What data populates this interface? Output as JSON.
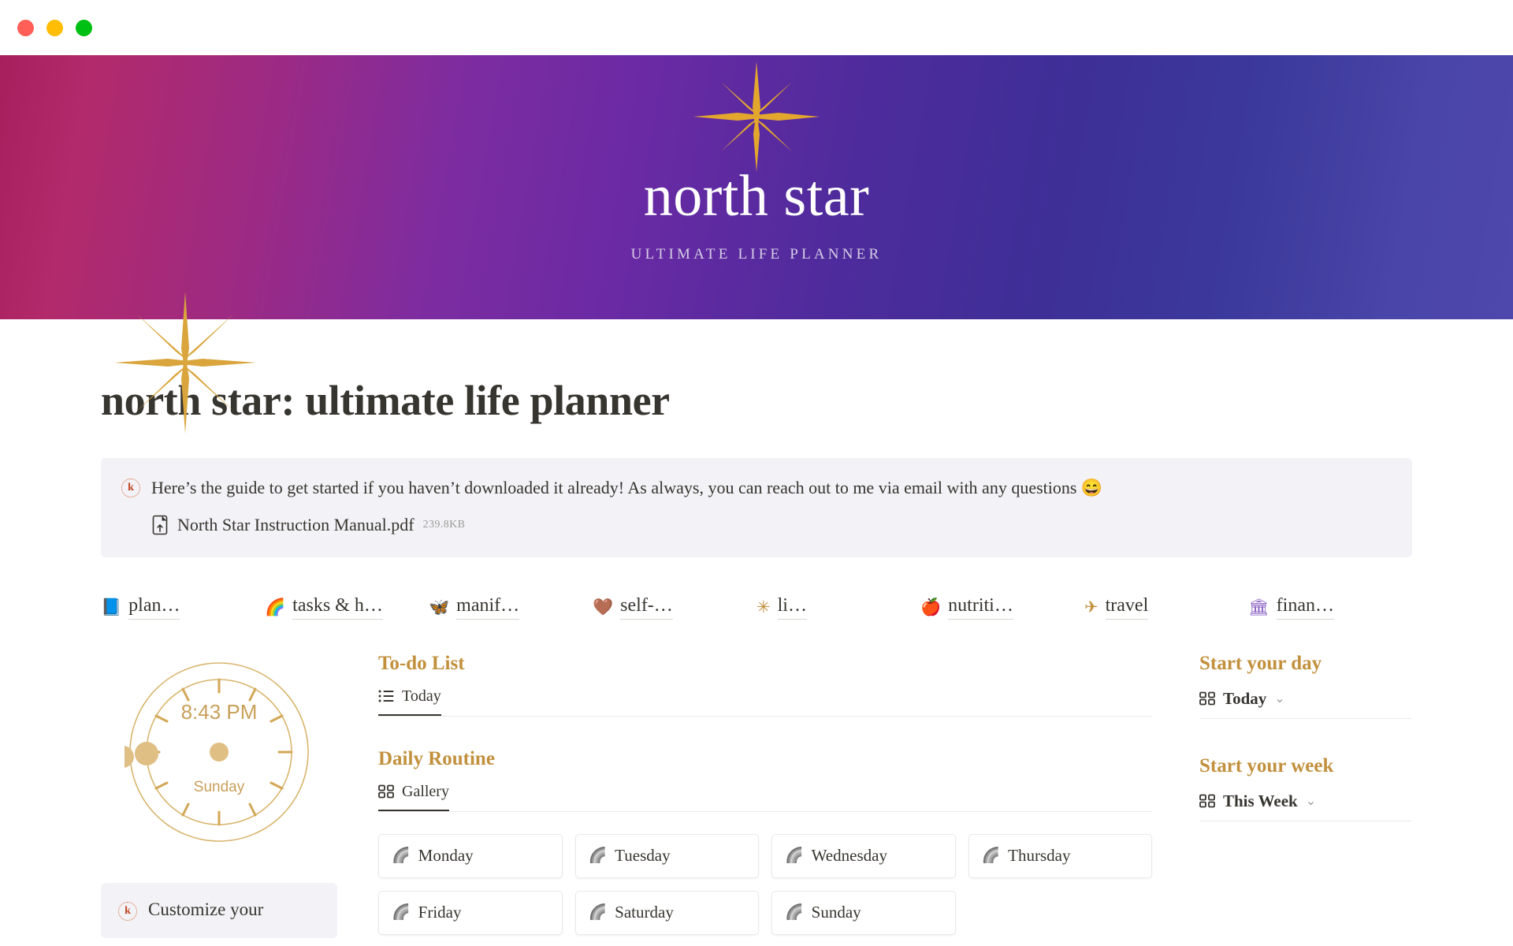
{
  "window": {
    "lights": [
      "close",
      "minimize",
      "zoom"
    ]
  },
  "banner": {
    "brand_name": "north star",
    "brand_subtitle": "ULTIMATE LIFE PLANNER",
    "star_icon": "four-point-star-icon",
    "corner_star_icon": "eight-point-star-icon",
    "gradient": [
      "#a81f5e",
      "#7d2ca0",
      "#3d2f96",
      "#4e47ac"
    ]
  },
  "page": {
    "title": "north star: ultimate life planner"
  },
  "callout": {
    "badge": "k",
    "text": "Here’s the guide to get started if you haven’t downloaded it already! As always, you can reach out to me via email with any questions 😄",
    "file": {
      "icon": "pdf-file-icon",
      "name": "North Star Instruction Manual.pdf",
      "size": "239.8KB"
    },
    "background": "#f3f2f7"
  },
  "tabs": [
    {
      "icon": "📘",
      "icon_name": "books-icon",
      "label": "plan…"
    },
    {
      "icon": "🌈",
      "icon_name": "rainbow-icon",
      "label": "tasks & h…"
    },
    {
      "icon": "🦋",
      "icon_name": "butterfly-icon",
      "label": "manif…"
    },
    {
      "icon": "🤎",
      "icon_name": "heart-icon",
      "label": "self-…"
    },
    {
      "icon": "✳",
      "icon_name": "sparkle-icon",
      "label": "li…"
    },
    {
      "icon": "🍎",
      "icon_name": "apple-icon",
      "label": "nutriti…"
    },
    {
      "icon": "✈",
      "icon_name": "airplane-icon",
      "label": "travel"
    },
    {
      "icon": "🏛",
      "icon_name": "bank-icon",
      "label": "finan…"
    }
  ],
  "clock": {
    "time": "8:43 PM",
    "day": "Sunday",
    "accent": "#d2a756"
  },
  "mini_callout": {
    "badge": "k",
    "text": "Customize your"
  },
  "sections": [
    {
      "title": "To-do List",
      "view_tab": {
        "label": "Today",
        "icon_name": "list-view-icon"
      }
    },
    {
      "title": "Daily Routine",
      "view_tab": {
        "label": "Gallery",
        "icon_name": "gallery-view-icon"
      }
    }
  ],
  "days": [
    {
      "icon": "🌈",
      "label": "Monday"
    },
    {
      "icon": "🌈",
      "label": "Tuesday"
    },
    {
      "icon": "🌈",
      "label": "Wednesday"
    },
    {
      "icon": "🌈",
      "label": "Thursday"
    },
    {
      "icon": "🌈",
      "label": "Friday"
    },
    {
      "icon": "🌈",
      "label": "Saturday"
    },
    {
      "icon": "🌈",
      "label": "Sunday"
    }
  ],
  "rail": [
    {
      "title": "Start your day",
      "value": "Today",
      "icon_name": "gallery-view-icon",
      "chevron": "⌄"
    },
    {
      "title": "Start your week",
      "value": "This Week",
      "icon_name": "gallery-view-icon",
      "chevron": "⌄"
    }
  ],
  "accent_gold": "#c2903d"
}
